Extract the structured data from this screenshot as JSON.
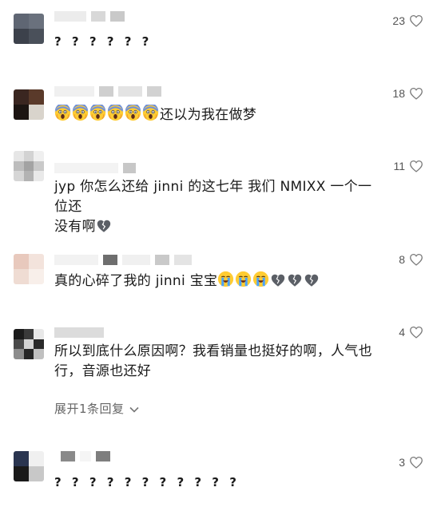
{
  "colors": {
    "text": "#1a1a1a",
    "muted": "#555555",
    "heart_outline": "#7a7a7a"
  },
  "comments": [
    {
      "text": "? ? ? ? ? ?",
      "likes": "23"
    },
    {
      "text": "还以为我在做梦",
      "emoji": "face-screaming-in-fear-icon",
      "emoji_count": 6,
      "likes": "18"
    },
    {
      "line1": "jyp 你怎么还给 jinni 的这七年 我们 NMIXX 一个一位还",
      "line2": "没有啊",
      "emoji": "broken-heart-icon",
      "likes": "11"
    },
    {
      "text": "真的心碎了我的 jinni 宝宝",
      "emoji_a": "loudly-crying-face-icon",
      "emoji_b": "broken-heart-icon",
      "likes": "8"
    },
    {
      "line1": "所以到底什么原因啊？我看销量也挺好的啊，人气也",
      "line2": "行，音源也还好",
      "likes": "4",
      "expand_label": "展开1条回复"
    },
    {
      "text": "? ? ? ? ? ? ? ? ? ? ?",
      "likes": "3"
    }
  ]
}
